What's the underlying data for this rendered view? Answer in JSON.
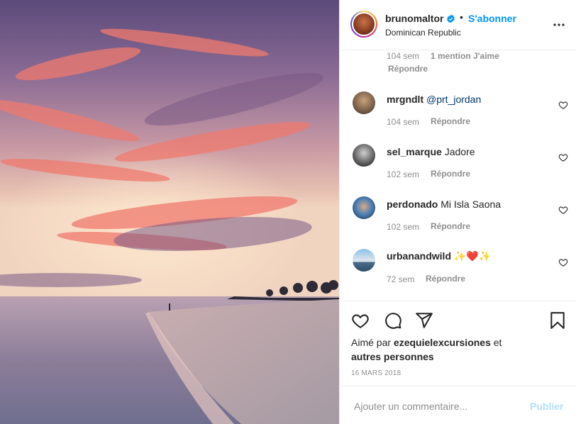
{
  "post": {
    "username": "brunomaltor",
    "separator": "•",
    "follow_label": "S'abonner",
    "location": "Dominican Republic",
    "brand_blue": "#0095f6"
  },
  "first_comment_meta": {
    "time": "104 sem",
    "likes": "1 mention J'aime",
    "reply": "Répondre"
  },
  "comments": [
    {
      "username": "mrgndlt",
      "text": "@prt_jordan",
      "time": "104 sem",
      "reply": "Répondre"
    },
    {
      "username": "sel_marque",
      "text": "Jadore",
      "time": "102 sem",
      "reply": "Répondre"
    },
    {
      "username": "perdonado",
      "text": "Mi Isla Saona",
      "time": "102 sem",
      "reply": "Répondre"
    },
    {
      "username": "urbanandwild",
      "text": "✨❤️✨",
      "time": "72 sem",
      "reply": "Répondre"
    }
  ],
  "likes": {
    "prefix": "Aimé par",
    "user": "ezequielexcursiones",
    "joiner": "et",
    "others": "autres personnes"
  },
  "date": "16 MARS 2018",
  "composer": {
    "placeholder": "Ajouter un commentaire...",
    "publish_label": "Publier"
  },
  "icons": [
    "verified-icon",
    "more-options-icon",
    "heart-icon",
    "comment-icon",
    "share-icon",
    "bookmark-icon"
  ]
}
